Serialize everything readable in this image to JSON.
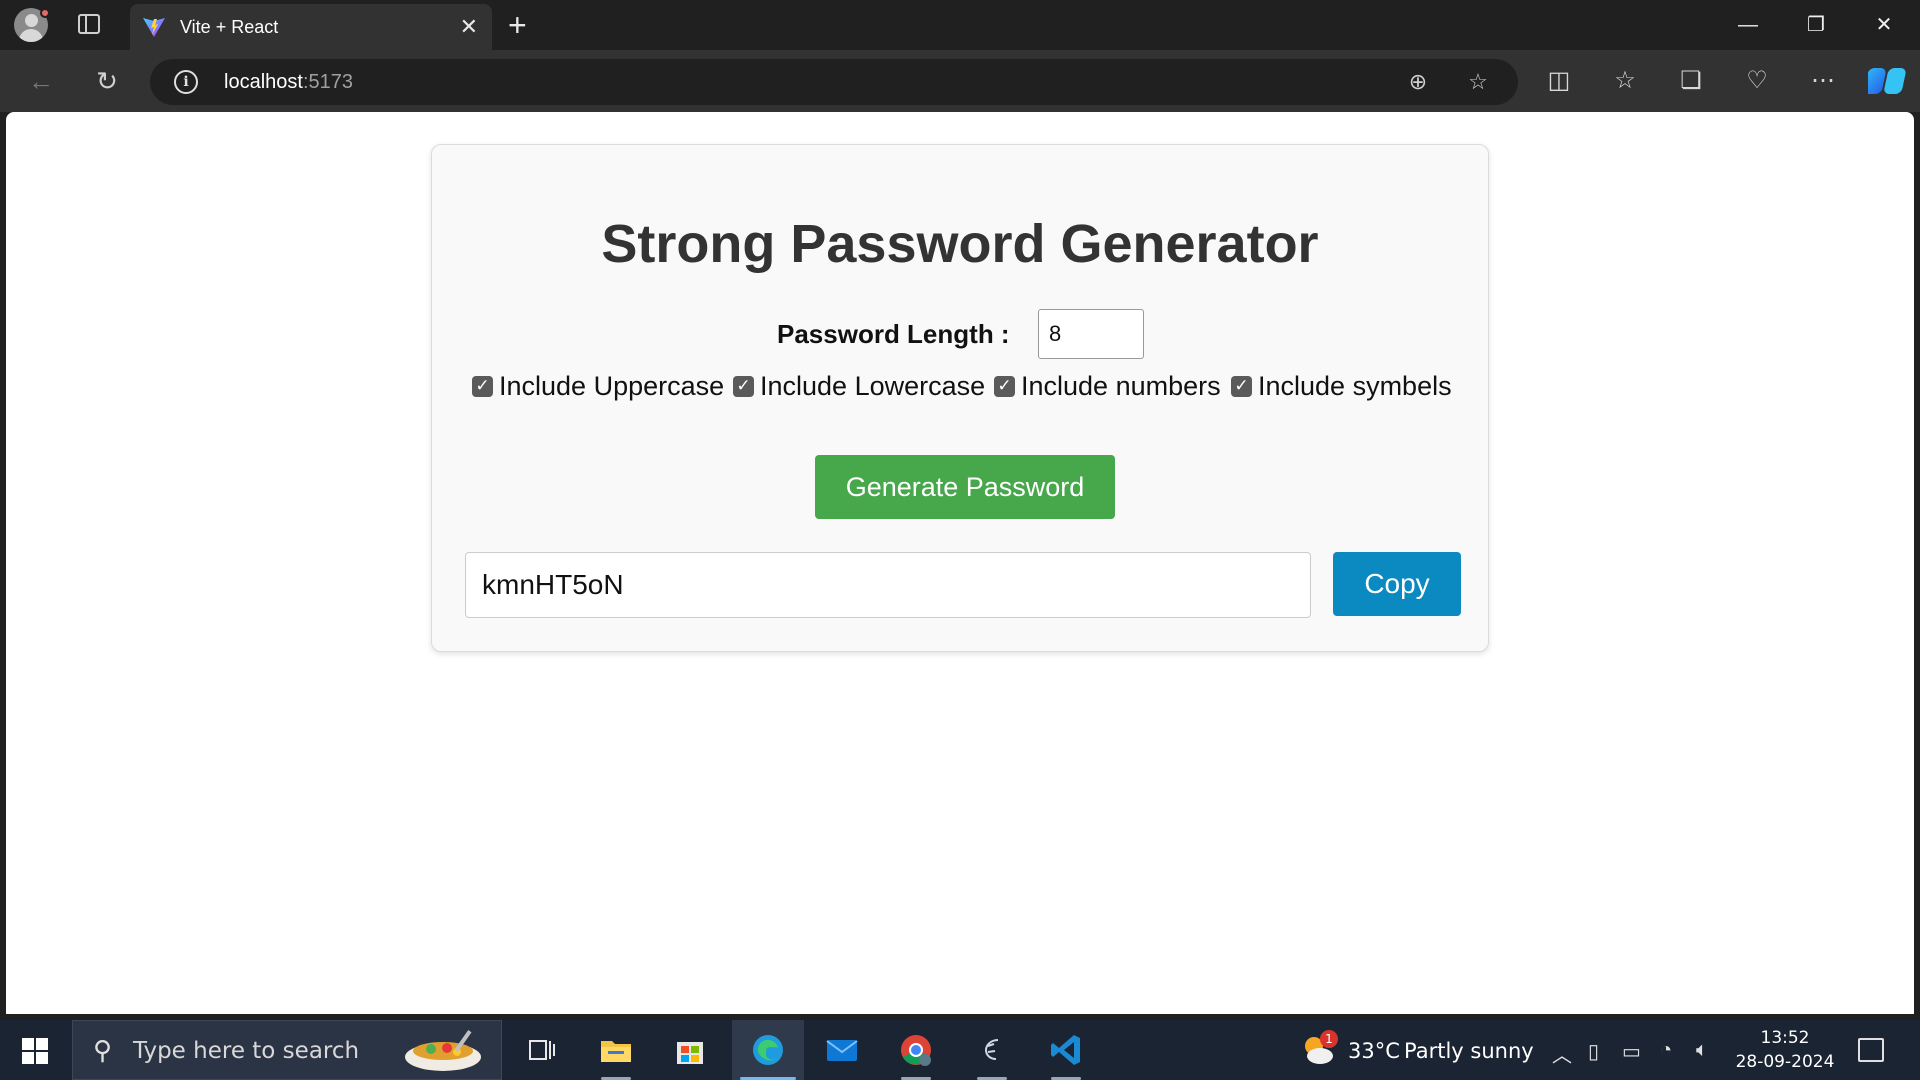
{
  "browser": {
    "tab_title": "Vite + React",
    "tab_close": "✕",
    "new_tab": "+",
    "url_host": "localhost",
    "url_port": ":5173",
    "window_controls": [
      "—",
      "❐",
      "✕"
    ]
  },
  "app": {
    "heading": "Strong Password Generator",
    "length_label": "Password Length :",
    "length_value": "8",
    "options": [
      {
        "label": "Include Uppercase",
        "checked": true
      },
      {
        "label": "Include Lowercase",
        "checked": true
      },
      {
        "label": "Include numbers",
        "checked": true
      },
      {
        "label": "Include symbels",
        "checked": true
      }
    ],
    "generate_label": "Generate Password",
    "password_value": "kmnHT5oN",
    "copy_label": "Copy",
    "colors": {
      "generate": "#47a84b",
      "copy": "#0a8ac0"
    }
  },
  "taskbar": {
    "search_placeholder": "Type here to search",
    "weather_badge": "1",
    "weather_temp": "33°C",
    "weather_desc": "Partly sunny",
    "time": "13:52",
    "date": "28-09-2024",
    "apps": [
      "task-view-icon",
      "file-explorer-icon",
      "microsoft-store-icon",
      "edge-icon",
      "mail-icon",
      "chrome-icon",
      "app-icon",
      "vscode-icon"
    ]
  }
}
